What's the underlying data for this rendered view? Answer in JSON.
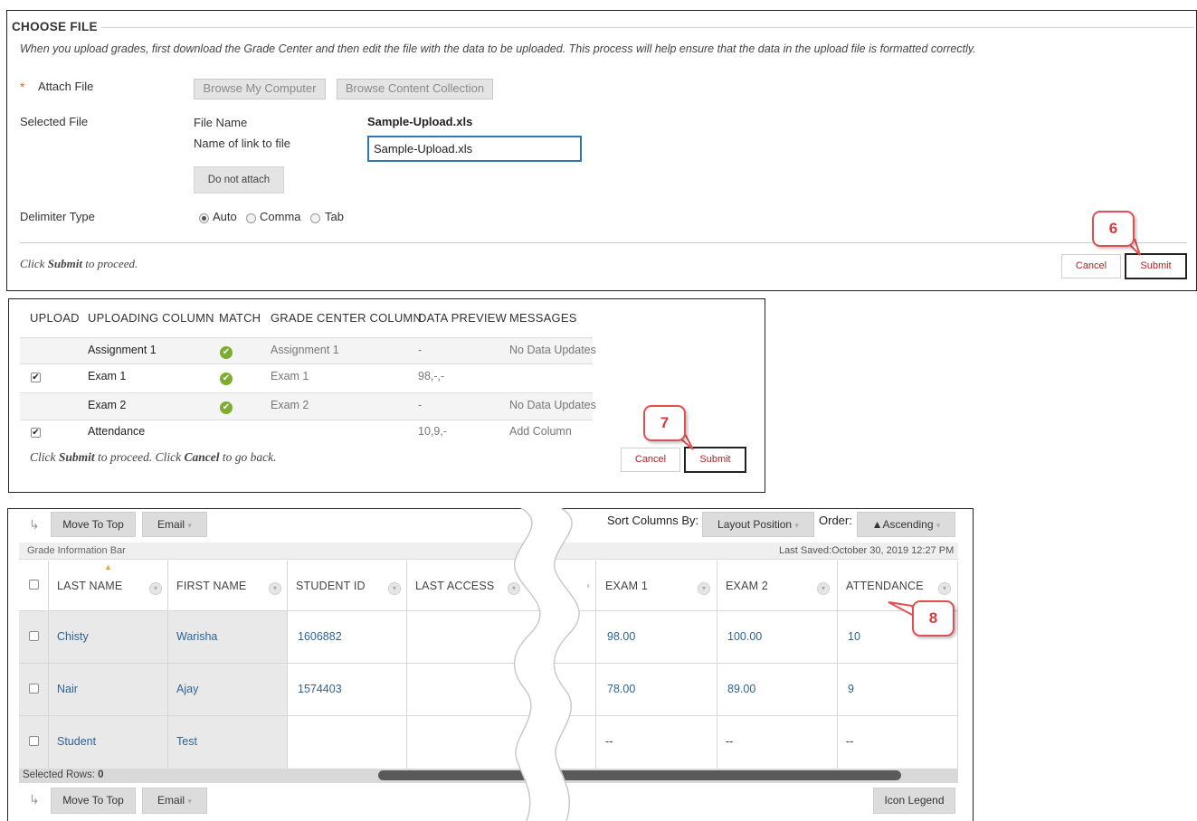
{
  "choose_file": {
    "heading": "CHOOSE FILE",
    "instructions": "When you upload grades, first download the Grade Center and then edit the file with the data to be uploaded. This process will help ensure that the data in the upload file is formatted correctly.",
    "required_mark": "*",
    "attach_label": "Attach File",
    "browse_computer": "Browse My Computer",
    "browse_collection": "Browse Content Collection",
    "selected_label": "Selected File",
    "file_name_label": "File Name",
    "file_name_value": "Sample-Upload.xls",
    "link_name_label": "Name of link to file",
    "link_name_value": "Sample-Upload.xls",
    "do_not_attach": "Do not attach",
    "delimiter_label": "Delimiter Type",
    "delimiter_options": [
      "Auto",
      "Comma",
      "Tab"
    ],
    "delimiter_selected": "Auto",
    "footer_prefix": "Click ",
    "footer_bold": "Submit",
    "footer_suffix": " to proceed.",
    "cancel": "Cancel",
    "submit": "Submit",
    "callout": "6"
  },
  "upload_preview": {
    "headers": [
      "UPLOAD",
      "UPLOADING COLUMN",
      "MATCH",
      "GRADE CENTER COLUMN",
      "DATA PREVIEW",
      "MESSAGES"
    ],
    "rows": [
      {
        "upload": false,
        "column": "Assignment 1",
        "match": true,
        "gc_column": "Assignment 1",
        "preview": "-",
        "message": "No Data Updates"
      },
      {
        "upload": true,
        "column": "Exam 1",
        "match": true,
        "gc_column": "Exam 1",
        "preview": "98,-,-",
        "message": ""
      },
      {
        "upload": false,
        "column": "Exam 2",
        "match": true,
        "gc_column": "Exam 2",
        "preview": "-",
        "message": "No Data Updates"
      },
      {
        "upload": true,
        "column": "Attendance",
        "match": false,
        "gc_column": "",
        "preview": "10,9,-",
        "message": "Add Column"
      }
    ],
    "footer_1": "Click ",
    "footer_b1": "Submit",
    "footer_2": " to proceed. Click ",
    "footer_b2": "Cancel",
    "footer_3": " to go back.",
    "cancel": "Cancel",
    "submit": "Submit",
    "callout": "7"
  },
  "grade_center": {
    "move_to_top": "Move To Top",
    "email": "Email",
    "sort_label": "Sort Columns By:",
    "sort_value": "Layout Position",
    "order_label": "Order:",
    "order_value": "▲Ascending",
    "info_bar": "Grade Information Bar",
    "last_saved": "Last Saved:October 30, 2019 12:27 PM",
    "columns_left": [
      "LAST NAME",
      "FIRST NAME",
      "STUDENT ID",
      "LAST ACCESS"
    ],
    "columns_right": [
      "EXAM 1",
      "EXAM 2",
      "ATTENDANCE"
    ],
    "rows": [
      {
        "last": "Chisty",
        "first": "Warisha",
        "id": "1606882",
        "access": "",
        "exam1": "98.00",
        "exam2": "100.00",
        "attendance": "10"
      },
      {
        "last": "Nair",
        "first": "Ajay",
        "id": "1574403",
        "access": "",
        "exam1": "78.00",
        "exam2": "89.00",
        "attendance": "9"
      },
      {
        "last": "Student",
        "first": "Test",
        "id": "",
        "access": "",
        "exam1": "--",
        "exam2": "--",
        "attendance": "--"
      }
    ],
    "selected_rows_label": "Selected Rows: ",
    "selected_rows_count": "0",
    "icon_legend": "Icon Legend",
    "callout": "8"
  },
  "colors": {
    "link": "#2a6496",
    "accent_red": "#b22222",
    "callout_red": "#e05050",
    "check_green": "#7cad2f"
  }
}
